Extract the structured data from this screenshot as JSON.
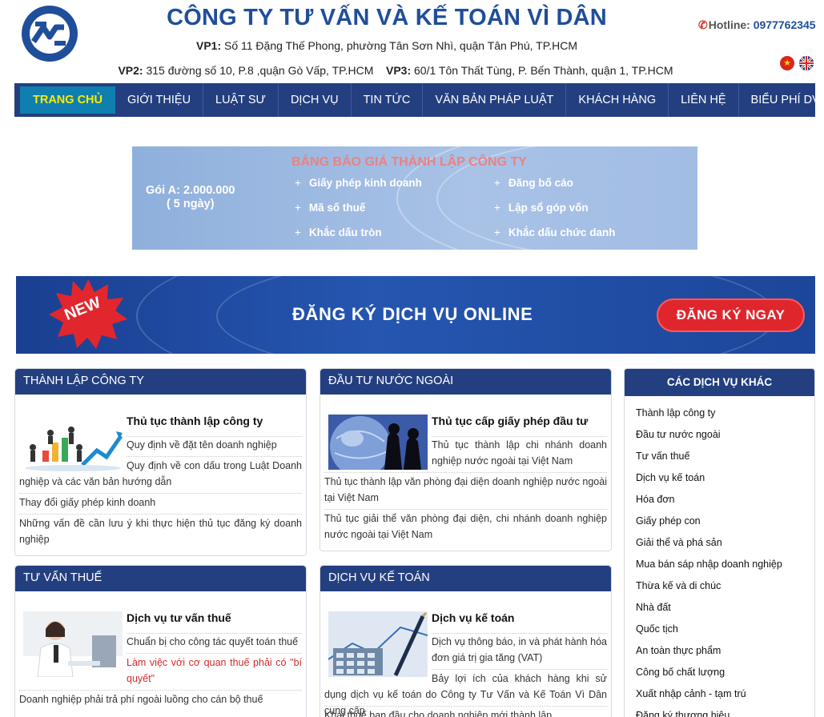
{
  "header": {
    "company_name": "CÔNG TY TƯ VẤN VÀ KẾ TOÁN VÌ DÂN",
    "vp1_label": "VP1:",
    "vp1_address": " Số 11 Đặng Thế Phong, phường Tân Sơn Nhì, quận Tân Phú, TP.HCM",
    "vp2_label": "VP2:",
    "vp2_address": " 315 đường số 10, P.8 ,quận Gò Vấp, TP.HCM",
    "vp3_label": "VP3:",
    "vp3_address": " 60/1 Tôn Thất Tùng, P. Bến Thành, quận 1, TP.HCM",
    "hotline_label": "Hotline: ",
    "hotline_number": "0977762345"
  },
  "nav": {
    "items": [
      "TRANG CHỦ",
      "GIỚI THIỆU",
      "LUẬT SƯ",
      "DỊCH VỤ",
      "TIN TỨC",
      "VĂN BẢN PHÁP LUẬT",
      "KHÁCH HÀNG",
      "LIÊN HỆ",
      "BIỂU PHÍ DV"
    ]
  },
  "price_banner": {
    "title": "BẢNG BÁO GIÁ THÀNH LẬP CÔNG TY",
    "package_line1": "Gói A: 2.000.000",
    "package_line2": "( 5 ngày)",
    "items": [
      "Giấy phép kinh doanh",
      "Mã số thuế",
      "Khắc dấu tròn",
      "Đăng bố cáo",
      "Lập sổ góp vốn",
      "Khắc dấu chức danh"
    ]
  },
  "register_banner": {
    "badge": "NEW",
    "text": "ĐĂNG KÝ DỊCH VỤ ONLINE",
    "button": "ĐĂNG KÝ NGAY"
  },
  "boxes": {
    "company": {
      "title": "THÀNH LẬP CÔNG TY",
      "featured": "Thủ tục thành lập công ty",
      "items": [
        "Quy định về đặt tên doanh nghiệp",
        "Quy định về con dấu trong Luật Doanh nghiệp và các văn bản hướng dẫn",
        "Thay đổi giấy phép kinh doanh",
        "Những vấn đề cần lưu ý khi thực hiện thủ tục đăng ký doanh nghiệp"
      ]
    },
    "foreign": {
      "title": "ĐẦU TƯ NƯỚC NGOÀI",
      "featured": "Thủ tục cấp giấy phép đầu tư",
      "items": [
        "Thủ tục thành lập chi nhánh doanh nghiệp nước ngoài tại Việt Nam",
        "Thủ tục thành lập văn phòng đại diện doanh nghiệp nước ngoài tại Việt Nam",
        "Thủ tục giải thể văn phòng đại diện, chi nhánh doanh nghiệp nước ngoài tại Việt Nam"
      ]
    },
    "tax": {
      "title": "TƯ VẤN THUẾ",
      "featured": "Dịch vụ tư vấn thuế",
      "items": [
        "Chuẩn bị cho công tác quyết toán thuế",
        "Làm việc với cơ quan thuế phải có \"bí quyết\"",
        "Doanh nghiệp phải trả phí ngoài luồng cho cán bộ thuế"
      ]
    },
    "accounting": {
      "title": "DỊCH VỤ KẾ TOÁN",
      "featured": "Dịch vụ kế toán",
      "items": [
        "Dịch vụ thông báo, in và phát hành hóa đơn giá trị gia tăng (VAT)",
        "Bảy lợi ích của khách hàng khi sử dụng dịch vụ kế toán do Công ty Tư Vấn và Kế Toán Vì Dân cung cấp",
        "Khai thuế ban đầu cho doanh nghiệp mới thành lập"
      ]
    }
  },
  "sidebar": {
    "title": "CÁC DỊCH VỤ KHÁC",
    "items": [
      "Thành lập công ty",
      "Đầu tư nước ngoài",
      "Tư vấn thuế",
      "Dịch vụ kế toán",
      "Hóa đơn",
      "Giấy phép con",
      "Giải thể và phá sản",
      "Mua bán sáp nhập doanh nghiệp",
      "Thừa kế và di chúc",
      "Nhà đất",
      "Quốc tịch",
      "An toàn thực phẩm",
      "Công bố chất lượng",
      "Xuất nhập cảnh - tạm trú",
      "Đăng ký thương hiệu"
    ]
  }
}
